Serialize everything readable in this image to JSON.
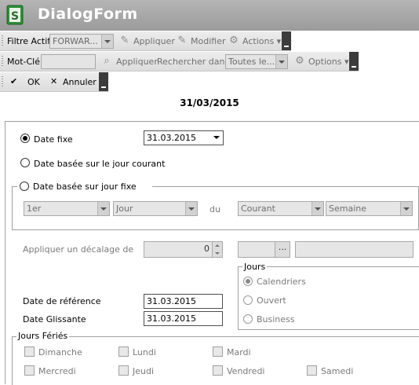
{
  "app": {
    "title": "DialogForm",
    "icon": "app-logo-icon"
  },
  "toolbar_filter": {
    "filter_label": "Filtre Actif",
    "filter_value": "FORWAR...",
    "apply_label": "Appliquer",
    "modify_label": "Modifier",
    "actions_label": "Actions"
  },
  "toolbar_search": {
    "keyword_label": "Mot-Clé",
    "keyword_value": "",
    "apply_label": "Appliquer",
    "search_in_label": "Rechercher dans",
    "search_in_value": "Toutes le...",
    "options_label": "Options"
  },
  "toolbar_dialog": {
    "ok_label": "OK",
    "cancel_label": "Annuler"
  },
  "header_date": "31/03/2015",
  "form": {
    "fixed_date_label": "Date fixe",
    "fixed_date_value": "31.03.2015",
    "current_day_label": "Date basée sur le jour courant",
    "fixed_day_label": "Date basée sur jour fixe",
    "fixed_day": {
      "combo1": "1er",
      "combo2": "Jour",
      "du_label": "du",
      "combo3": "Courant",
      "combo4": "Semaine"
    },
    "offset_label": "Appliquer un décalage de",
    "offset_value": "0",
    "offset_btn": "...",
    "jours_group": {
      "title": "Jours",
      "options": [
        "Calendriers",
        "Ouvert",
        "Business"
      ]
    },
    "ref_date_label": "Date de référence",
    "ref_date_value": "31.03.2015",
    "rolling_date_label": "Date Glissante",
    "rolling_date_value": "31.03.2015",
    "holidays": {
      "title": "Jours Fériés",
      "days": [
        "Dimanche",
        "Lundi",
        "Mardi",
        "Mercredi",
        "Jeudi",
        "Vendredi",
        "Samedi"
      ]
    }
  },
  "colors": {
    "titlebar": "#a6a6a6",
    "toolbar_end": "#3c3c3c",
    "disabled_text": "#7a7a7a"
  }
}
